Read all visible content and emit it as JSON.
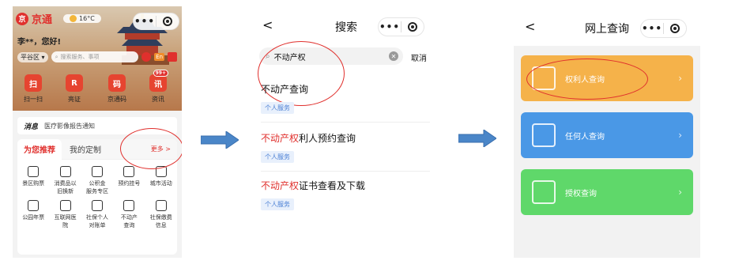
{
  "panel1": {
    "app_name": "京通",
    "logo_char": "京",
    "weather": "16°C",
    "greeting": "李**，您好!",
    "district": "平谷区 ▾",
    "search_placeholder": "搜索服务、事项",
    "lang": "En",
    "quick": [
      {
        "icon": "扫",
        "label": "扫一扫"
      },
      {
        "icon": "R",
        "label": "亮证"
      },
      {
        "icon": "码",
        "label": "京通码"
      },
      {
        "icon": "讯",
        "label": "资讯",
        "badge": "99+"
      }
    ],
    "news_tag": "消息",
    "news_text": "医疗影像报告通知",
    "tab_recommend": "为您推荐",
    "tab_custom": "我的定制",
    "more": "更多 >",
    "grid": [
      "景区购票",
      "消费品以\n旧换新",
      "公积金\n服务专区",
      "预约挂号",
      "城市活动",
      "公园年票",
      "互联网医\n院",
      "社保个人\n对账单",
      "不动产\n查询",
      "社保缴费\n信息"
    ]
  },
  "panel2": {
    "title": "搜索",
    "back": "<",
    "query": "不动产权",
    "cancel": "取消",
    "results": [
      {
        "prefix": "",
        "highlight": "",
        "text": "不动产查询",
        "tag": "个人服务"
      },
      {
        "prefix": "",
        "highlight": "不动产权",
        "text": "利人预约查询",
        "tag": "个人服务"
      },
      {
        "prefix": "",
        "highlight": "不动产权",
        "text": "证书查看及下载",
        "tag": "个人服务"
      }
    ]
  },
  "panel3": {
    "title": "网上查询",
    "back": "<",
    "buttons": [
      {
        "label": "权利人查询",
        "color": "#f5b24a"
      },
      {
        "label": "任何人查询",
        "color": "#4a98e6"
      },
      {
        "label": "授权查询",
        "color": "#5fd86a"
      }
    ]
  },
  "colors": {
    "accent": "#e0302d",
    "arrow": "#4a86c8"
  }
}
